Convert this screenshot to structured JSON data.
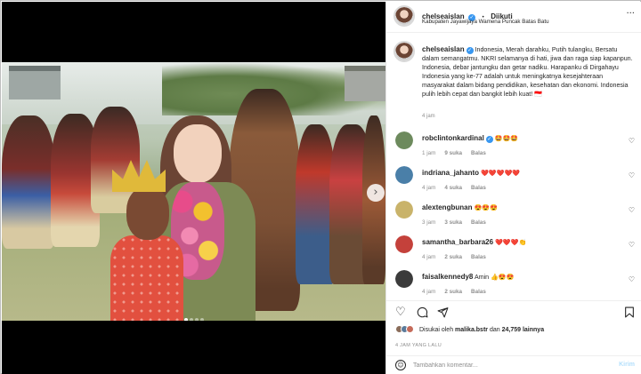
{
  "post": {
    "username": "chelseaislan",
    "follow_label": "Diikuti",
    "location": "Kabupaten Jayawijaya Wamena Puncak Batas Batu",
    "more_icon": "more-horizontal-icon"
  },
  "caption": {
    "username": "chelseaislan",
    "text": "Indonesia, Merah darahku, Putih tulangku, Bersatu dalam semangatmu. NKRI selamanya di hati, jiwa dan raga siap kapanpun. Indonesia, debar jantungku dan getar nadiku. Harapanku di Dirgahayu Indonesia yang ke-77 adalah untuk meningkatnya kesejahteraan masyarakat dalam bidang pendidikan, kesehatan dan ekonomi. Indonesia pulih lebih cepat dan bangkit lebih kuat! 🇮🇩",
    "time": "4 jam"
  },
  "comments": [
    {
      "username": "robclintonkardinal",
      "text": "🤩🤩🤩",
      "time": "1 jam",
      "likes": "9 suka",
      "reply": "Balas",
      "verified": true,
      "avatar_color": "#6d8a5d"
    },
    {
      "username": "indriana_jahanto",
      "text": "❤️❤️❤️❤️❤️",
      "time": "4 jam",
      "likes": "4 suka",
      "reply": "Balas",
      "verified": false,
      "avatar_color": "#4a7fa8"
    },
    {
      "username": "alextengbunan",
      "text": "😍😍😍",
      "time": "3 jam",
      "likes": "3 suka",
      "reply": "Balas",
      "verified": false,
      "avatar_color": "#c9b36a"
    },
    {
      "username": "samantha_barbara26",
      "text": "❤️❤️❤️👏",
      "time": "4 jam",
      "likes": "2 suka",
      "reply": "Balas",
      "verified": false,
      "avatar_color": "#c4413b"
    },
    {
      "username": "faisalkennedy8",
      "text": "Amin 👍😍😍",
      "time": "4 jam",
      "likes": "2 suka",
      "reply": "Balas",
      "verified": false,
      "avatar_color": "#3b3b3b"
    }
  ],
  "actions": {
    "like_icon": "heart-icon",
    "comment_icon": "comment-icon",
    "share_icon": "send-icon",
    "save_icon": "bookmark-icon"
  },
  "likes": {
    "prefix": "Disukai oleh",
    "user": "malika.bstr",
    "connector": "dan",
    "count": "24,759 lainnya"
  },
  "posted_ago": "4 JAM YANG LALU",
  "add_comment": {
    "placeholder": "Tambahkan komentar...",
    "post_label": "Kirim"
  },
  "carousel": {
    "current": 1,
    "total": 4
  },
  "colors": {
    "verified": "#3897f0",
    "post_button_disabled": "#b2dffc",
    "heart_red": "#ed4956"
  }
}
